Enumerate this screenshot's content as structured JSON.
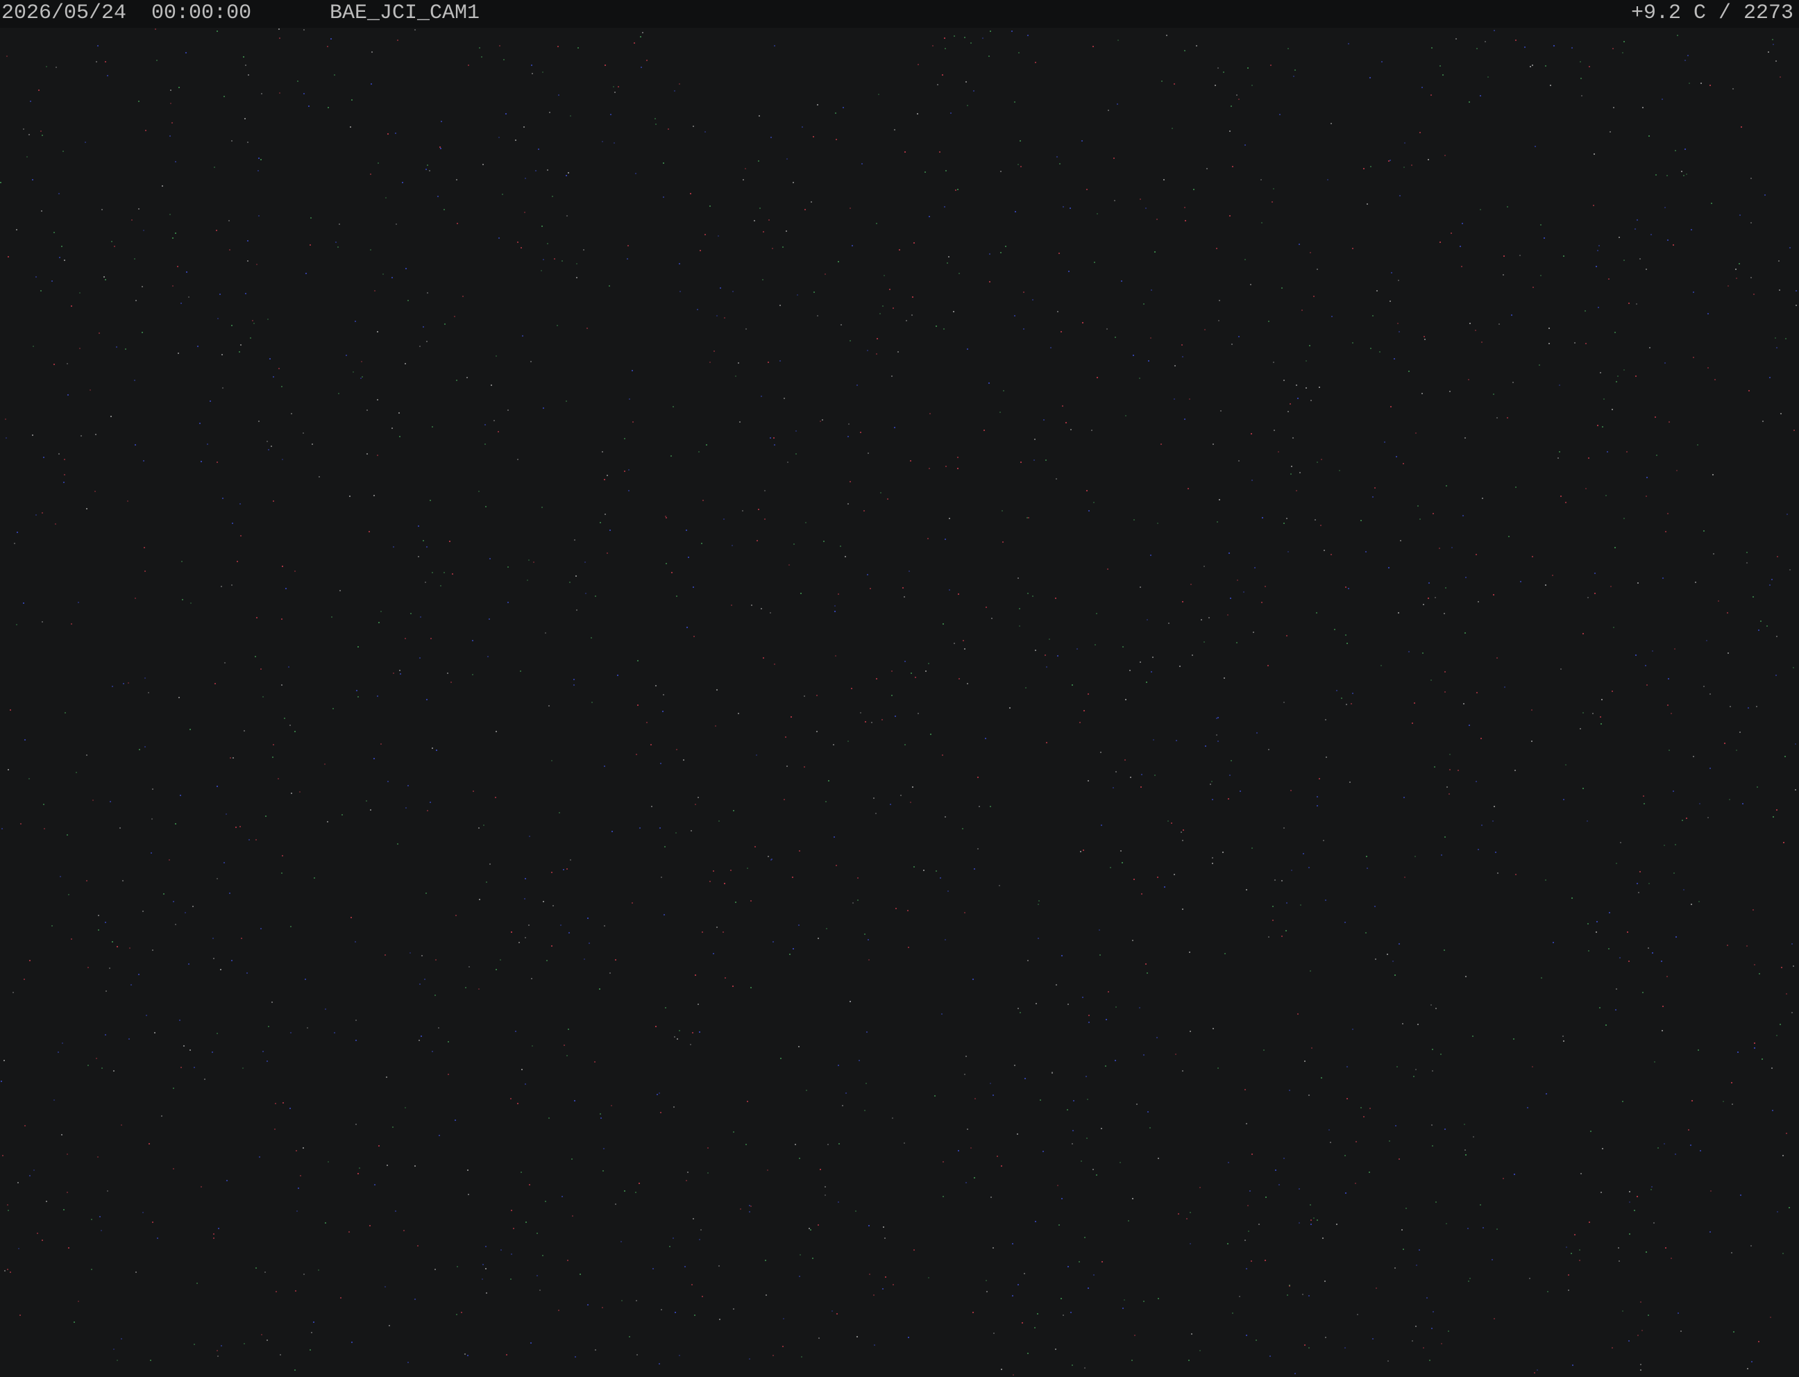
{
  "overlay": {
    "date": "2026/05/24",
    "time": "00:00:00",
    "camera": "BAE_JCI_CAM1",
    "temperature": "+9.2 C",
    "counter": "2273"
  },
  "image": {
    "content": "dark night-sky camera frame with faint sensor noise",
    "background_color": "#151617",
    "noise_colors": [
      "#c23a4a",
      "#3a4ac2",
      "#3f8f4f",
      "#9a9a9a"
    ]
  }
}
